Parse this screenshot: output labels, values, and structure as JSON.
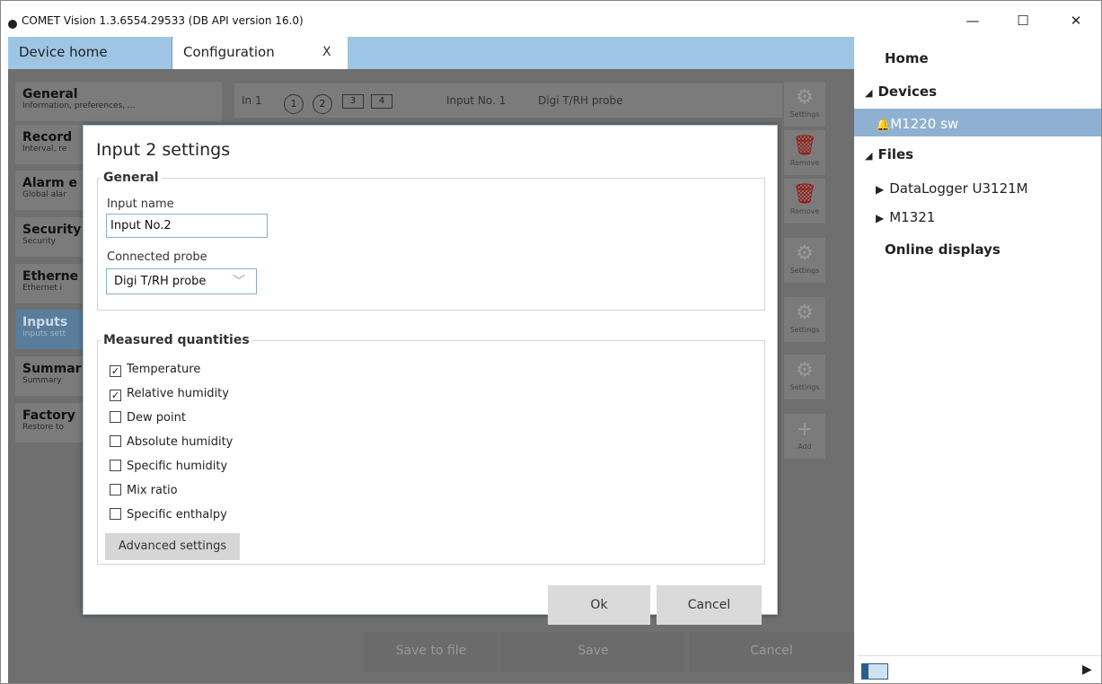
{
  "window": {
    "title": "COMET Vision 1.3.6554.29533 (DB API version 16.0)",
    "minimize": "—",
    "maximize": "☐",
    "close": "✕"
  },
  "tabs": {
    "home": "Device home",
    "config": "Configuration",
    "config_close": "X"
  },
  "nav": [
    {
      "title": "General",
      "sub": "Information, preferences, ..."
    },
    {
      "title": "Record",
      "sub": "Interval, re"
    },
    {
      "title": "Alarm e",
      "sub": "Global alar"
    },
    {
      "title": "Security",
      "sub": "Security"
    },
    {
      "title": "Etherne",
      "sub": "Ethernet i"
    },
    {
      "title": "Inputs",
      "sub": "Inputs sett"
    },
    {
      "title": "Summar",
      "sub": "Summary"
    },
    {
      "title": "Factory",
      "sub": "Restore to"
    }
  ],
  "inputbar": {
    "in_label": "In 1",
    "n1": "1",
    "n2": "2",
    "n3": "3",
    "n4": "4",
    "input_name": "Input No. 1",
    "probe": "Digi T/RH probe"
  },
  "sidebuttons": {
    "settings": "Settings",
    "remove": "Remove",
    "add": "Add"
  },
  "bottom": {
    "save_to_file": "Save to file",
    "save": "Save",
    "cancel": "Cancel"
  },
  "right_panel": {
    "home": "Home",
    "devices": "Devices",
    "device": "M1220 sw",
    "files": "Files",
    "file1": "DataLogger U3121M",
    "file2": "M1321",
    "online": "Online displays"
  },
  "dialog": {
    "title": "Input 2 settings",
    "general_legend": "General",
    "input_name_label": "Input name",
    "input_name_value": "Input No.2",
    "probe_label": "Connected probe",
    "probe_value": "Digi T/RH probe",
    "measured_legend": "Measured quantities",
    "quantities": [
      {
        "label": "Temperature",
        "checked": true
      },
      {
        "label": "Relative humidity",
        "checked": true
      },
      {
        "label": "Dew point",
        "checked": false
      },
      {
        "label": "Absolute humidity",
        "checked": false
      },
      {
        "label": "Specific humidity",
        "checked": false
      },
      {
        "label": "Mix ratio",
        "checked": false
      },
      {
        "label": "Specific enthalpy",
        "checked": false
      }
    ],
    "advanced": "Advanced settings",
    "ok": "Ok",
    "cancel": "Cancel"
  },
  "colors": {
    "accent": "#9ec5e4",
    "selected": "#8fb1d1",
    "alarm_icon": "#d11c1c"
  }
}
